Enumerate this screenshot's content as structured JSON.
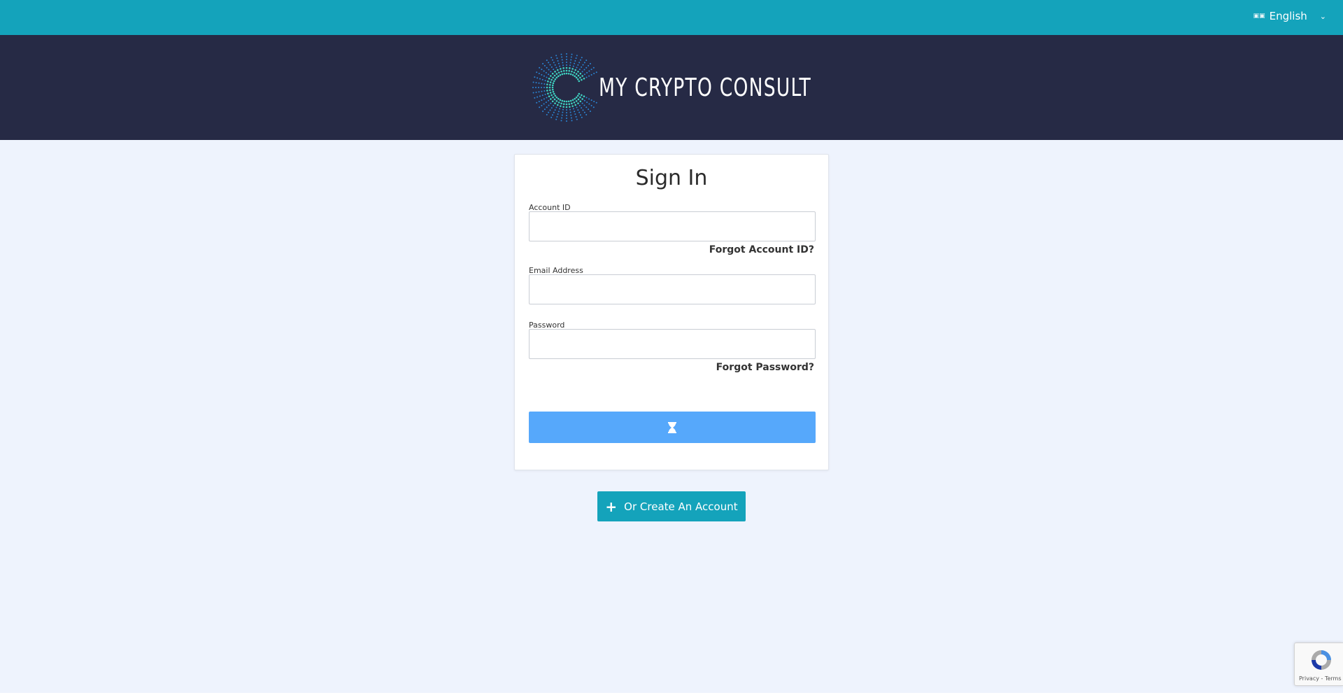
{
  "topbar": {
    "language": "English",
    "flag_icon": "flag-icon",
    "chevron_icon": "chevron-down-icon",
    "color": "#14a3bb"
  },
  "header": {
    "brand_name": "MY CRYPTO CONSULT",
    "logo_icon": "starburst-logo-icon",
    "color": "#262a45"
  },
  "signin": {
    "title": "Sign In",
    "account_id_label": "Account ID",
    "account_id_value": "",
    "forgot_account_id": "Forgot Account ID?",
    "email_label": "Email Address",
    "email_value": "",
    "password_label": "Password",
    "password_value": "",
    "forgot_password": "Forgot Password?",
    "submit_icon": "hourglass-icon",
    "submit_color": "#56a8fb"
  },
  "create_account": {
    "label": "Or Create An Account",
    "icon": "plus-icon"
  },
  "recaptcha": {
    "text": "Privacy - Terms"
  }
}
